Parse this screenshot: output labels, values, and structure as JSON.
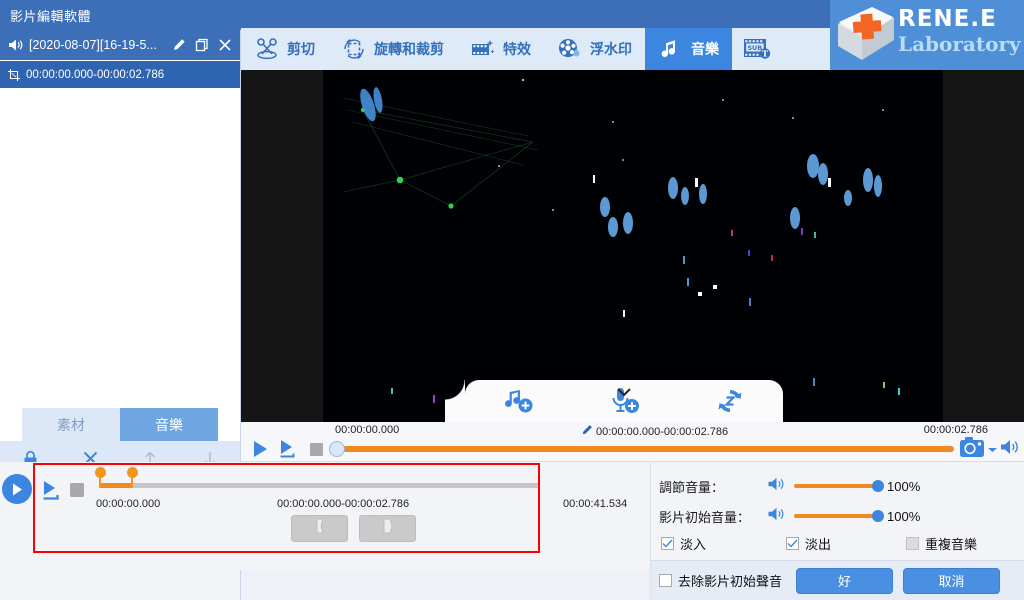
{
  "window": {
    "app_title": "影片編輯軟體"
  },
  "sidebar": {
    "clip": {
      "name": "[2020-08-07][16-19-5...",
      "speaker_icon": "speaker-icon",
      "edit_icon": "pencil-icon",
      "duplicate_icon": "copy-icon",
      "close_icon": "close-icon",
      "range": "00:00:00.000-00:00:02.786",
      "crop_icon": "crop-icon"
    },
    "tabs": [
      {
        "label": "素材",
        "name": "tab-material",
        "active": false
      },
      {
        "label": "音樂",
        "name": "tab-music",
        "active": true
      }
    ],
    "tools": [
      {
        "name": "lock-icon"
      },
      {
        "name": "close-icon"
      },
      {
        "name": "arrow-up-icon"
      },
      {
        "name": "arrow-down-icon"
      }
    ]
  },
  "toolbar": {
    "items": [
      {
        "label": "剪切",
        "icon": "scissors-icon",
        "active": false
      },
      {
        "label": "旋轉和裁剪",
        "icon": "rotate-crop-icon",
        "active": false
      },
      {
        "label": "特效",
        "icon": "film-sparkle-icon",
        "active": false
      },
      {
        "label": "浮水印",
        "icon": "film-reel-drop-icon",
        "active": false
      },
      {
        "label": "音樂",
        "icon": "music-note-icon",
        "active": true
      },
      {
        "label": "",
        "icon": "subtitle-icon",
        "active": false
      }
    ]
  },
  "brand": {
    "line1": "RENE.E",
    "line2": "Laboratory",
    "logo_icon": "red-cross-key-icon"
  },
  "preview": {
    "overlay_buttons": [
      {
        "name": "add-music-icon"
      },
      {
        "name": "add-voice-record-icon"
      },
      {
        "name": "replace-audio-icon"
      }
    ],
    "collapse_icon": "chevron-down-icon"
  },
  "player": {
    "time_start": "00:00:00.000",
    "time_range": "00:00:00.000-00:00:02.786",
    "time_end": "00:00:02.786",
    "range_edit_icon": "pencil-icon",
    "controls": [
      {
        "name": "play-button",
        "icon": "play-icon"
      },
      {
        "name": "play-selection-button",
        "icon": "play-range-icon"
      },
      {
        "name": "stop-button",
        "icon": "stop-icon"
      }
    ],
    "snapshot_icon": "camera-icon",
    "snapshot_dropdown_icon": "chevron-down-icon",
    "volume_icon": "speaker-icon",
    "progress_percent": 0
  },
  "audio_editor": {
    "play_icon": "play-circle-icon",
    "play_range_icon": "play-range-icon",
    "stop_icon": "stop-icon",
    "time_left": "00:00:00.000",
    "time_selection": "00:00:00.000-00:00:02.786",
    "time_total": "00:00:41.534",
    "trim_buttons": [
      {
        "name": "trim-start-button",
        "icon": "trim-left-icon"
      },
      {
        "name": "trim-end-button",
        "icon": "trim-right-icon"
      }
    ],
    "selection_start_percent": 0,
    "selection_end_percent": 7
  },
  "settings": {
    "rows": [
      {
        "label": "調節音量：",
        "value": "100%",
        "percent": 100,
        "name": "adjust-volume"
      },
      {
        "label": "影片初始音量：",
        "value": "100%",
        "percent": 100,
        "name": "original-video-volume"
      }
    ],
    "checkboxes": [
      {
        "label": "淡入",
        "checked": true,
        "disabled": false,
        "name": "fade-in-checkbox"
      },
      {
        "label": "淡出",
        "checked": true,
        "disabled": false,
        "name": "fade-out-checkbox"
      },
      {
        "label": "重複音樂",
        "checked": false,
        "disabled": true,
        "name": "repeat-music-checkbox"
      }
    ],
    "remove_audio": {
      "label": "去除影片初始聲音",
      "checked": false,
      "name": "remove-original-audio-checkbox"
    },
    "ok_label": "好",
    "cancel_label": "取消"
  },
  "colors": {
    "title_blue": "#3d6fb8",
    "accent_blue": "#3d86e0",
    "orange": "#f08a20",
    "highlight_red": "#fb0000",
    "toolbar_bg": "#dfeaf8"
  }
}
